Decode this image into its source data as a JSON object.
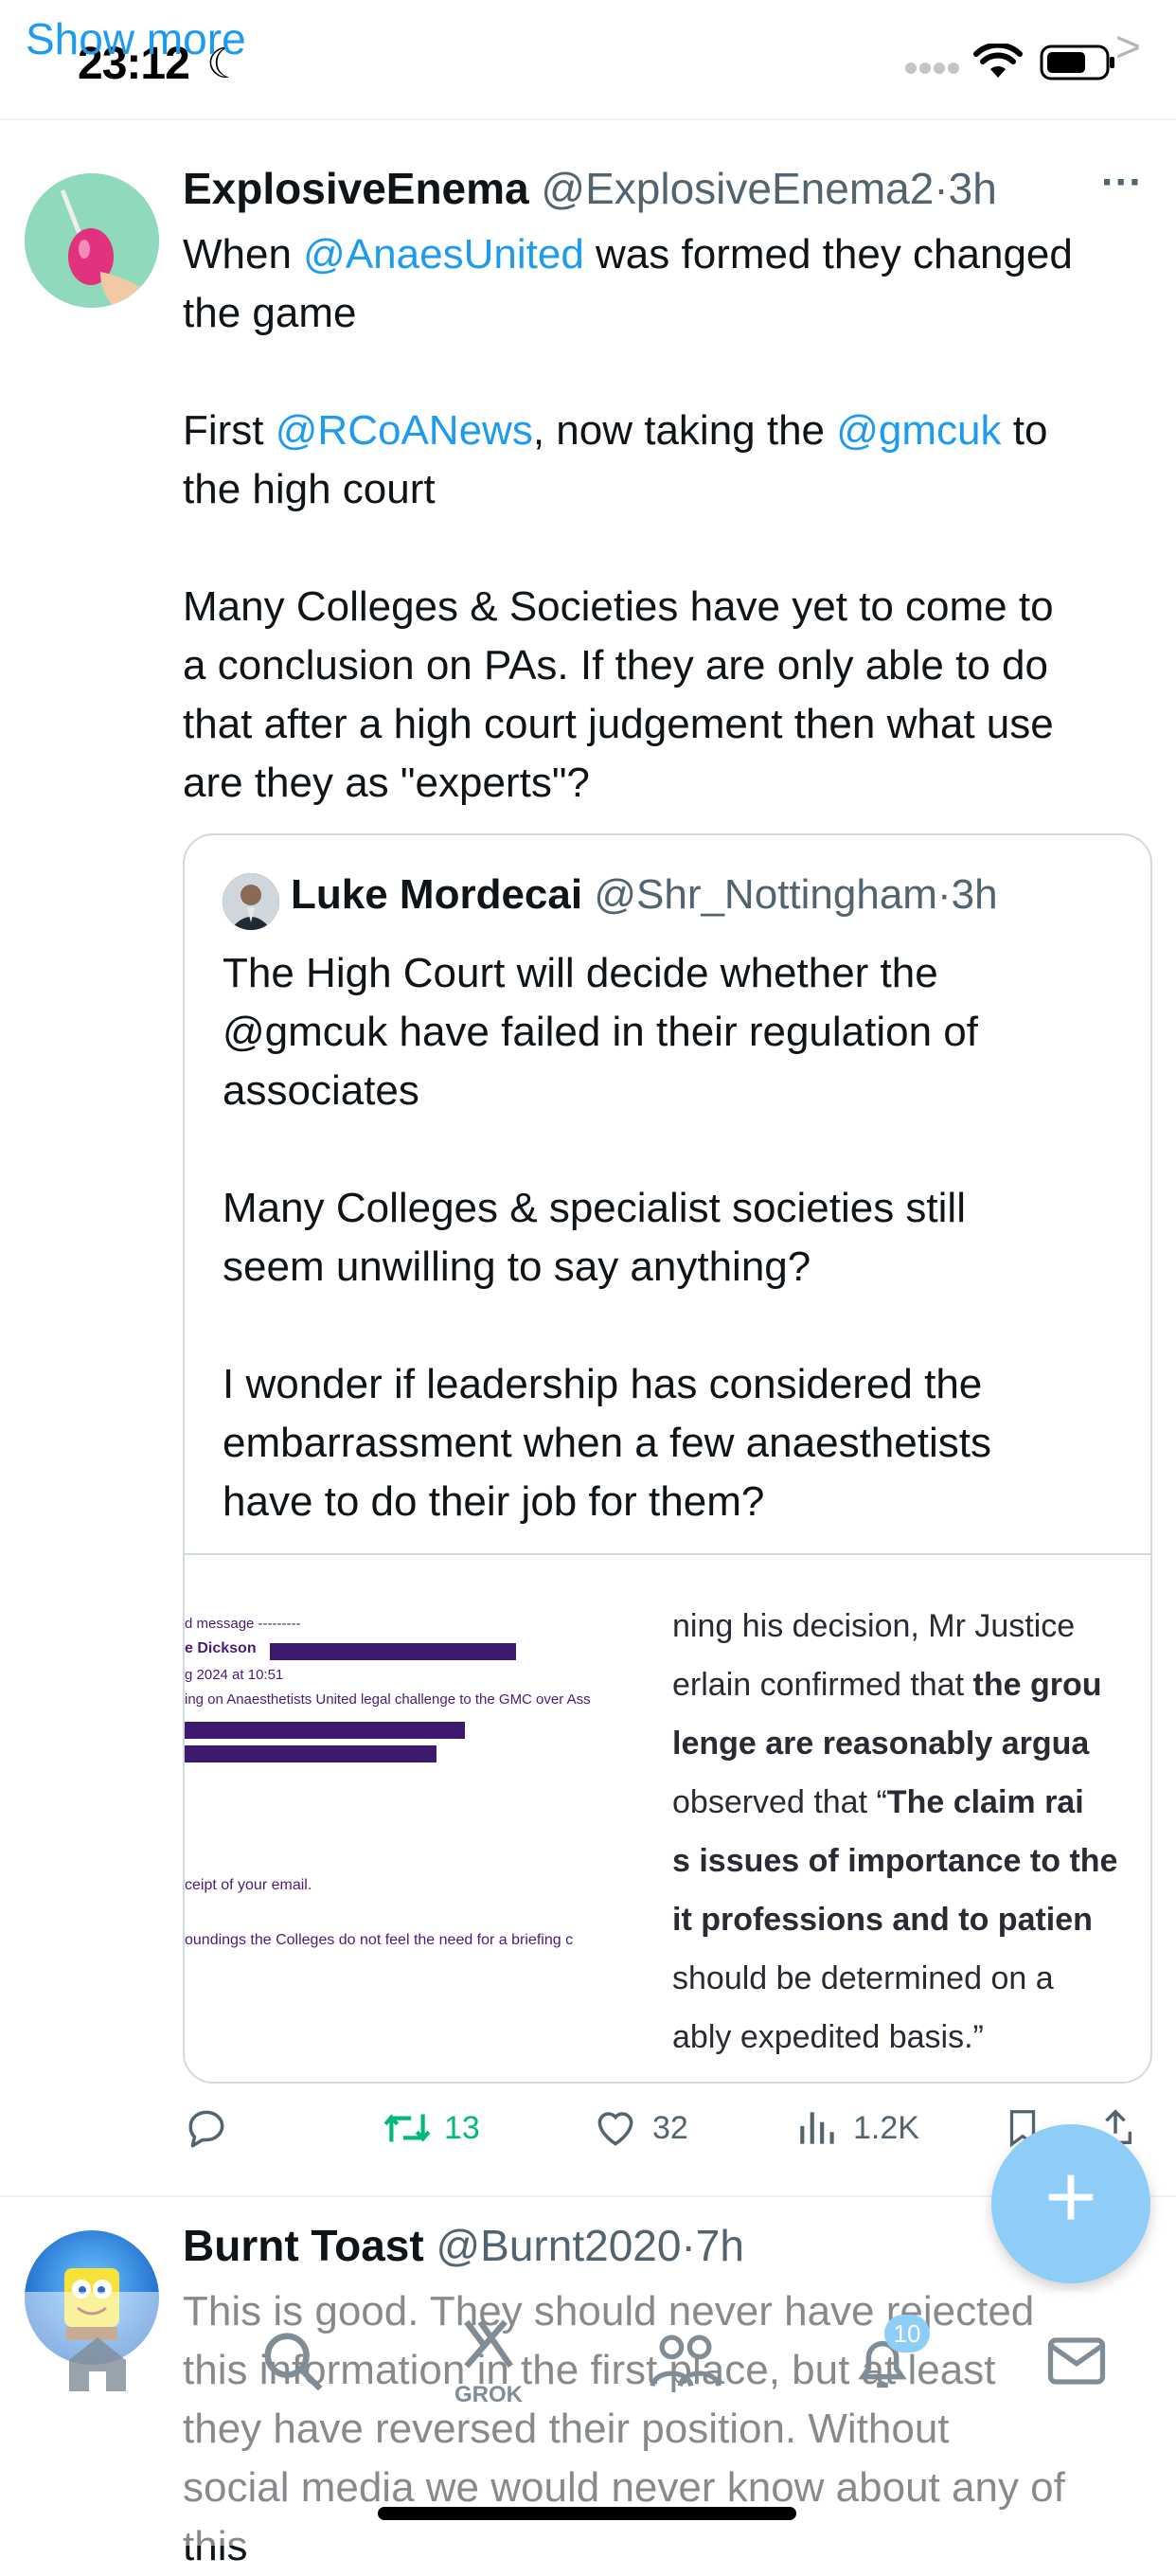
{
  "status_bar": {
    "time": "23:12",
    "moon": "☾",
    "show_more": "Show more",
    "chevron": ">"
  },
  "tweet1": {
    "display_name": "ExplosiveEnema",
    "handle": "@ExplosiveEnema2",
    "sep": "·",
    "time": "3h",
    "more": "···",
    "line1_pre": "When ",
    "mention_anaes": "@AnaesUnited",
    "line1_post": " was formed they changed",
    "line2": "the game",
    "line3_pre": "First ",
    "mention_rcoa": "@RCoANews",
    "line3_mid": ", now taking the ",
    "mention_gmc": "@gmcuk",
    "line3_post": " to",
    "line4": "the high court",
    "line5": "Many Colleges & Societies have yet to come to",
    "line6": "a conclusion on PAs. If they are only able to do",
    "line7": "that after a high court judgement then what use",
    "line8": "are they as \"experts\"?"
  },
  "quote": {
    "display_name": "Luke Mordecai",
    "handle": "@Shr_Nottingham",
    "sep": "·",
    "time": "3h",
    "line1": "The High Court will decide whether the",
    "line2": "@gmcuk have failed in their regulation of",
    "line3": "associates",
    "line4": "Many Colleges & specialist societies still",
    "line5": "seem unwilling to say anything?",
    "line6": "I wonder if leadership has considered the",
    "line7": "embarrassment when a few anaesthetists",
    "line8": "have to do their job for them?"
  },
  "email_image": {
    "l1": "d message ---------",
    "l2": "e Dickson",
    "l3": "g 2024 at 10:51",
    "l4": "ing on Anaesthetists United legal challenge to the GMC over Ass",
    "l5": "ceipt of your email.",
    "l6": "oundings the Colleges do not feel the need for a briefing c",
    "redact_color": "#3d1a6e"
  },
  "ruling_image": {
    "l1": "ning his decision, Mr Justice",
    "l2_pre": "erlain confirmed that ",
    "l2_bold": "the grou",
    "l3": "lenge are reasonably argua",
    "l4_pre": "observed that “",
    "l4_bold": "The claim rai",
    "l5": "s issues of importance to the",
    "l6": "it professions and to patien",
    "l7": "should be determined on a",
    "l8": "ably expedited basis.”"
  },
  "actions": {
    "reply_icon": "reply-icon",
    "retweet_count": "13",
    "like_count": "32",
    "views_count": "1.2K",
    "retweet_color": "#00ba7c"
  },
  "fab": {
    "label": "+"
  },
  "tweet2": {
    "display_name": "Burnt Toast",
    "handle": "@Burnt2020",
    "sep": "·",
    "time": "7h",
    "more": "···",
    "line1": "This is good. They should never have rejected",
    "line2": "this information in the first place, but at least",
    "line3": "they have reversed their position. Without",
    "line4": "social media we would never know about any of",
    "line5": "this"
  },
  "tabbar": {
    "grok_label": "GROK",
    "notifications_badge": "10"
  },
  "colors": {
    "accent": "#1d9bf0",
    "text": "#0f1419",
    "secondary": "#536471",
    "border": "#cfd9de"
  }
}
